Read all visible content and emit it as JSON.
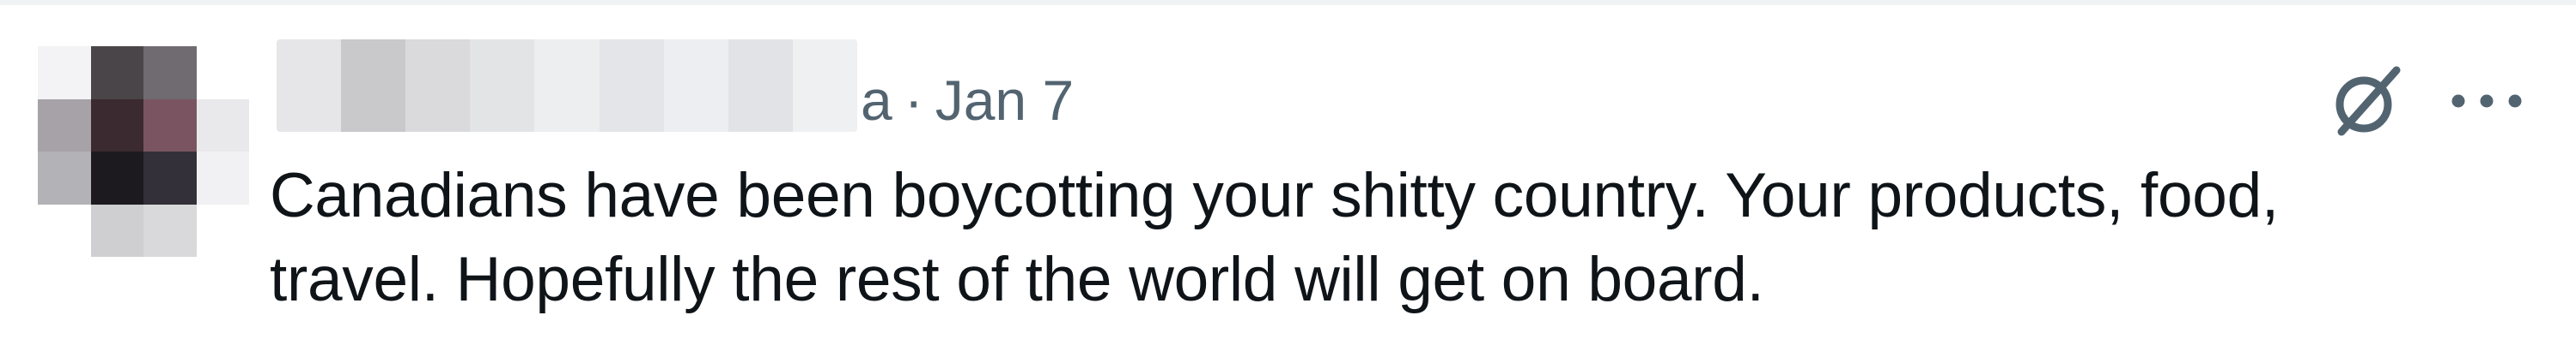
{
  "tweet": {
    "handle_tail": "a",
    "separator": "·",
    "date": "Jan 7",
    "text_lines": [
      "Canadians have been boycotting your shitty country. Your products, food,",
      "travel. Hopefully the rest of the world will get on board."
    ]
  },
  "icons": {
    "grok": "grok-icon",
    "more": "more-icon"
  },
  "colors": {
    "text_primary": "#0f1419",
    "text_secondary": "#536471"
  }
}
